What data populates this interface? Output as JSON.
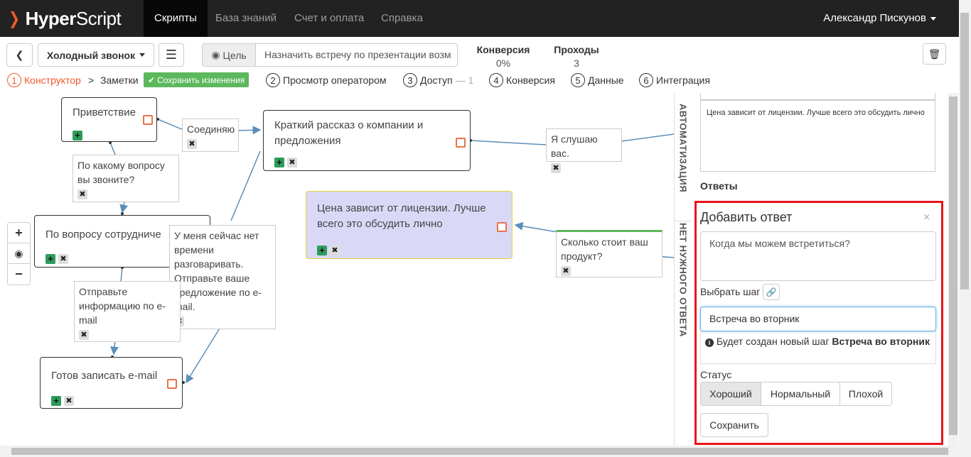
{
  "nav": {
    "brand_bold": "Hyper",
    "brand_light": "Script",
    "tabs": [
      "Скрипты",
      "База знаний",
      "Счет и оплата",
      "Справка"
    ],
    "user": "Александр Пискунов"
  },
  "toolbar": {
    "script_name": "Холодный звонок",
    "goal_label": "Цель",
    "goal_value": "Назначить встречу по презентации возм",
    "conversion_label": "Конверсия",
    "conversion_value": "0%",
    "passes_label": "Проходы",
    "passes_value": "3"
  },
  "steps": {
    "s1_num": "1",
    "s1": "Конструктор",
    "sep": ">",
    "notes": "Заметки",
    "save": "Сохранить изменения",
    "s2_num": "2",
    "s2": "Просмотр оператором",
    "s3_num": "3",
    "s3": "Доступ",
    "s3_extra": "— 1",
    "s4_num": "4",
    "s4": "Конверсия",
    "s5_num": "5",
    "s5": "Данные",
    "s6_num": "6",
    "s6": "Интеграция"
  },
  "nodes": {
    "greeting": "Приветствие",
    "story": "Краткий рассказ о компании и предложения",
    "employee": "По вопросу сотрудниче",
    "price": "Цена зависит от лицензии. Лучше всего это обсудить лично",
    "email": "Готов записать e-mail"
  },
  "labels": {
    "connect": "Соединяю",
    "listen": "Я слушаю вас.",
    "question": "По какому вопросу вы звоните?",
    "howmuch": "Сколько стоит ваш продукт?",
    "busy": "У меня сейчас нет времени разговаривать. Отправьте ваше предложение по e-mail.",
    "sendinfo": "Отправьте информацию по e-mail"
  },
  "vtabs": {
    "auto": "АВТОМАТИЗАЦИЯ",
    "noanswer": "НЕТ НУЖНОГО ОТВЕТА"
  },
  "panel": {
    "step_text": "Цена зависит от лицензии. Лучше всего это обсудить лично",
    "answers_title": "Ответы",
    "add_title": "Добавить ответ",
    "answer_text": "Когда мы можем встретиться?",
    "choose_step": "Выбрать шаг",
    "new_step_value": "Встреча во вторник",
    "info_prefix": "Будет создан новый шаг",
    "info_bold": "Встреча во вторник",
    "status_label": "Статус",
    "status_options": [
      "Хороший",
      "Нормальный",
      "Плохой"
    ],
    "save": "Сохранить"
  },
  "colors": {
    "accent": "#f0592a",
    "green": "#5cb85c",
    "highlight": "#e8131a",
    "edge": "#5b8fb9"
  }
}
